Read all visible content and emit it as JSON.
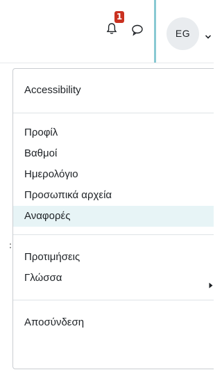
{
  "navbar": {
    "notifications": {
      "icon": "bell-icon",
      "badge_count": "1"
    },
    "messages": {
      "icon": "chat-bubble-icon"
    },
    "user": {
      "initials": "EG",
      "dropdown_icon": "chevron-down-icon"
    },
    "colors": {
      "badge": "#ca3120",
      "accent_divider": "#88c9d3",
      "active_item_bg": "#e7f4f6",
      "avatar_bg": "#e9ecef"
    }
  },
  "user_menu": {
    "groups": [
      {
        "items": [
          {
            "label": "Accessibility"
          }
        ]
      },
      {
        "items": [
          {
            "label": "Προφίλ"
          },
          {
            "label": "Βαθμοί"
          },
          {
            "label": "Ημερολόγιο"
          },
          {
            "label": "Προσωπικά αρχεία"
          },
          {
            "label": "Αναφορές",
            "active": true
          }
        ]
      },
      {
        "items": [
          {
            "label": "Προτιμήσεις"
          },
          {
            "label": "Γλώσσα",
            "has_submenu": true,
            "submenu_icon": "caret-right-icon"
          }
        ]
      },
      {
        "items": [
          {
            "label": "Αποσύνδεση"
          }
        ]
      }
    ]
  }
}
